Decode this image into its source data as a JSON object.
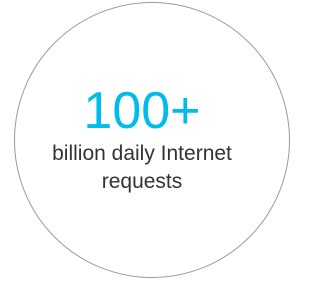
{
  "stat": {
    "value": "100+",
    "label_line1": "billion daily Internet",
    "label_line2": "requests"
  },
  "colors": {
    "accent": "#00bceb",
    "text": "#333333",
    "circle_border": "#9a9a9a"
  }
}
